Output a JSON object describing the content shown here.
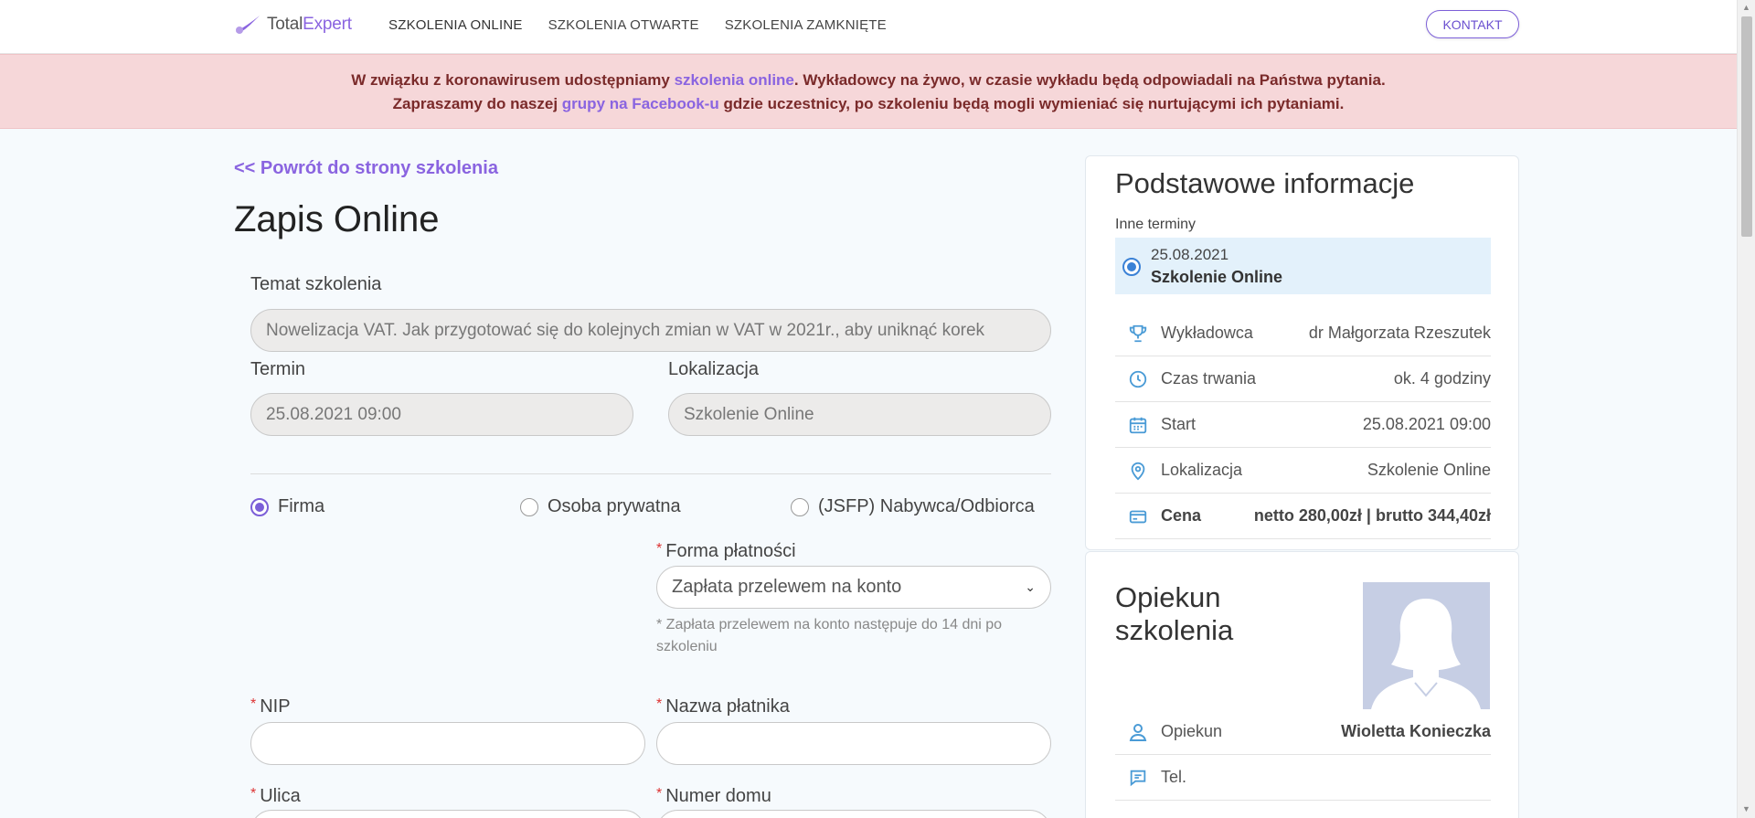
{
  "header": {
    "logo_part1": "Total",
    "logo_part2": "Expert",
    "nav": [
      "SZKOLENIA ONLINE",
      "SZKOLENIA OTWARTE",
      "SZKOLENIA ZAMKNIĘTE"
    ],
    "contact_label": "KONTAKT"
  },
  "banner": {
    "line1_a": "W związku z koronawirusem udostępniamy ",
    "line1_link": "szkolenia online",
    "line1_b": ". Wykładowcy na żywo, w czasie wykładu będą odpowiadali na Państwa pytania.",
    "line2_a": "Zapraszamy do naszej ",
    "line2_link": "grupy na Facebook-u",
    "line2_b": " gdzie uczestnicy, po szkoleniu będą mogli wymieniać się nurtującymi ich pytaniami."
  },
  "form": {
    "back_link": "<< Powrót do strony szkolenia",
    "title": "Zapis Online",
    "topic_label": "Temat szkolenia",
    "topic_value": "Nowelizacja VAT. Jak przygotować się do kolejnych zmian w VAT w 2021r., aby uniknąć korek",
    "term_label": "Termin",
    "term_value": "25.08.2021 09:00",
    "location_label": "Lokalizacja",
    "location_value": "Szkolenie Online",
    "buyer_types": [
      "Firma",
      "Osoba prywatna",
      "(JSFP) Nabywca/Odbiorca"
    ],
    "selected_buyer": "Firma",
    "payment_label": "Forma płatności",
    "payment_value": "Zapłata przelewem na konto",
    "payment_note": "* Zapłata przelewem na konto następuje do 14 dni po szkoleniu",
    "nip_label": "NIP",
    "payer_label": "Nazwa płatnika",
    "street_label": "Ulica",
    "house_label": "Numer domu",
    "required_mark": "*"
  },
  "info": {
    "title": "Podstawowe informacje",
    "other_terms_label": "Inne terminy",
    "term_date": "25.08.2021",
    "term_name": "Szkolenie Online",
    "rows": [
      {
        "icon": "trophy-icon",
        "key": "Wykładowca",
        "value": "dr Małgorzata Rzeszutek"
      },
      {
        "icon": "clock-icon",
        "key": "Czas trwania",
        "value": "ok. 4 godziny"
      },
      {
        "icon": "calendar-icon",
        "key": "Start",
        "value": "25.08.2021 09:00"
      },
      {
        "icon": "location-pin-icon",
        "key": "Lokalizacja",
        "value": "Szkolenie Online"
      },
      {
        "icon": "credit-card-icon",
        "key": "Cena",
        "value": "netto 280,00zł | brutto 344,40zł"
      }
    ]
  },
  "guardian": {
    "title_line1": "Opiekun",
    "title_line2": "szkolenia",
    "rows": [
      {
        "icon": "user-icon",
        "key": "Opiekun",
        "value": "Wioletta Konieczka"
      },
      {
        "icon": "message-icon",
        "key": "Tel.",
        "value": ""
      }
    ]
  },
  "colors": {
    "accent": "#8a64e0",
    "banner_bg": "#f6d7d9",
    "banner_text": "#7a2a2a",
    "info_icon": "#4a9bd6"
  }
}
